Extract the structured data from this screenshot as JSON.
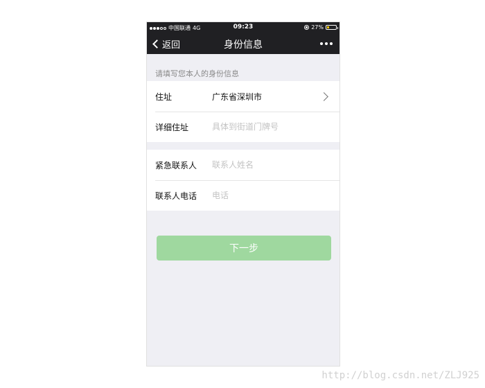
{
  "status_bar": {
    "carrier": "中国联通",
    "network": "4G",
    "time": "09:23",
    "battery": "27%",
    "battery_level": 0.27,
    "signal_bars_filled": 3,
    "signal_bars_total": 5
  },
  "nav": {
    "back_label": "返回",
    "title": "身份信息"
  },
  "form": {
    "hint": "请填写您本人的身份信息",
    "address": {
      "label": "住址",
      "value": "广东省深圳市"
    },
    "detail_address": {
      "label": "详细住址",
      "placeholder": "具体到街道门牌号"
    },
    "emergency_contact": {
      "label": "紧急联系人",
      "placeholder": "联系人姓名"
    },
    "contact_phone": {
      "label": "联系人电话",
      "placeholder": "电话"
    }
  },
  "next_button": {
    "label": "下一步",
    "color": "#9fd89f"
  },
  "watermark": "http://blog.csdn.net/ZLJ925"
}
